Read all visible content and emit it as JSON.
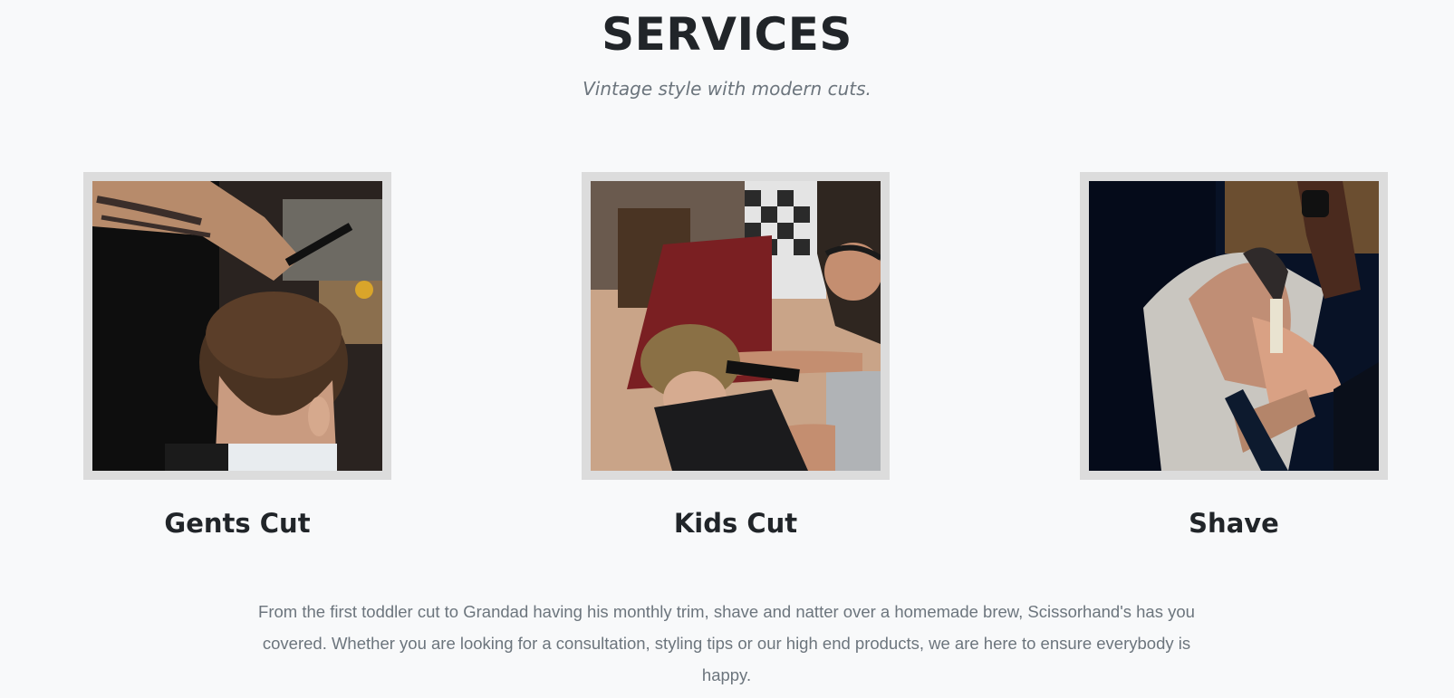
{
  "section": {
    "title": "SERVICES",
    "subtitle": "Vintage style with modern cuts."
  },
  "services": [
    {
      "title": "Gents Cut"
    },
    {
      "title": "Kids Cut"
    },
    {
      "title": "Shave"
    }
  ],
  "description": "From the first toddler cut to Grandad having his monthly trim, shave and natter over a homemade brew, Scissorhand's has you covered. Whether you are looking for a consultation, styling tips or our high end products, we are here to ensure everybody is happy.",
  "colors": {
    "background": "#f8f9fa",
    "heading": "#212529",
    "muted": "#6c757d",
    "frame": "#dcdcdc"
  }
}
